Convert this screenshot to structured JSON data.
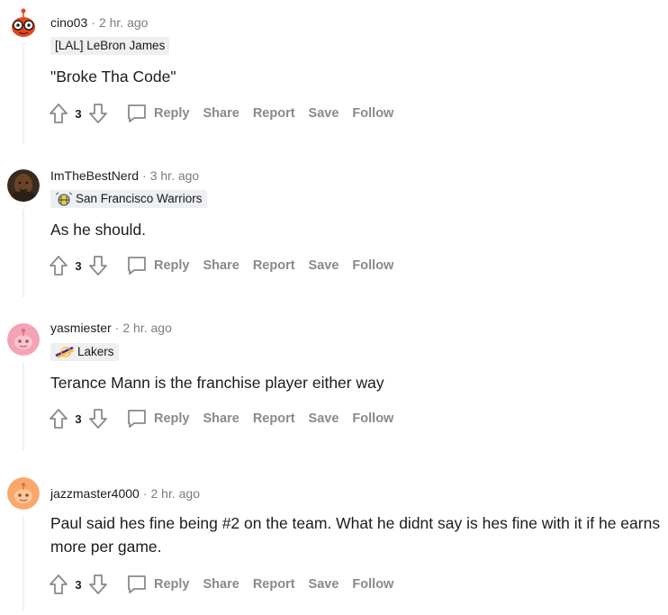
{
  "comments": [
    {
      "username": "cino03",
      "time": "2 hr. ago",
      "flair": "[LAL] LeBron James",
      "flair_icon": "",
      "avatar": "snoo-red-glasses",
      "body": "\"Broke Tha Code\"",
      "score": "3"
    },
    {
      "username": "ImTheBestNerd",
      "time": "3 hr. ago",
      "flair": "San Francisco Warriors",
      "flair_icon": "warriors-bridge-icon",
      "avatar": "photo-person",
      "body": "As he should.",
      "score": "3"
    },
    {
      "username": "yasmiester",
      "time": "2 hr. ago",
      "flair": "Lakers",
      "flair_icon": "lakers-logo-icon",
      "avatar": "snoo-pink",
      "body": "Terance Mann is the franchise player either way",
      "score": "3"
    },
    {
      "username": "jazzmaster4000",
      "time": "2 hr. ago",
      "flair": "",
      "flair_icon": "",
      "avatar": "snoo-orange",
      "body": "Paul said hes fine being #2 on the team. What he didnt say is hes fine with it if he earns more per game.",
      "score": "3"
    }
  ],
  "actions": {
    "reply": "Reply",
    "share": "Share",
    "report": "Report",
    "save": "Save",
    "follow": "Follow"
  },
  "colors": {
    "action_text": "#878a8c",
    "meta_text": "#7c7c7c",
    "flair_bg": "#edeff1",
    "thread_line": "#edeff1"
  }
}
